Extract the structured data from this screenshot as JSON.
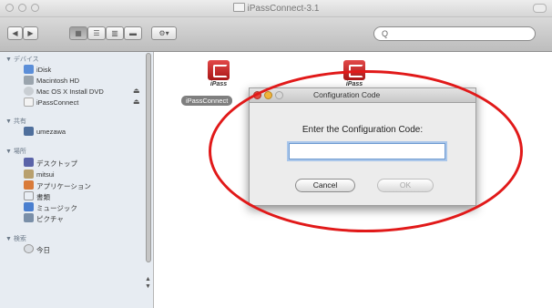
{
  "window": {
    "title": "iPassConnect-3.1"
  },
  "toolbar": {
    "nav_back": "◀",
    "nav_forward": "▶",
    "view_modes": [
      "▦",
      "☰",
      "▥",
      "▬"
    ],
    "action": "⚙▾",
    "search_placeholder": "Q"
  },
  "sidebar": {
    "sections": [
      {
        "header": "▼ デバイス",
        "items": [
          {
            "label": "iDisk",
            "icon": "idisk-icon",
            "eject": false
          },
          {
            "label": "Macintosh HD",
            "icon": "hard-disk-icon",
            "eject": false
          },
          {
            "label": "Mac OS X Install DVD",
            "icon": "dvd-icon",
            "eject": true
          },
          {
            "label": "iPassConnect",
            "icon": "disk-image-icon",
            "eject": true
          }
        ]
      },
      {
        "header": "▼ 共有",
        "items": [
          {
            "label": "umezawa",
            "icon": "shared-computer-icon",
            "eject": false
          }
        ]
      },
      {
        "header": "▼ 場所",
        "items": [
          {
            "label": "デスクトップ",
            "icon": "desktop-icon",
            "eject": false
          },
          {
            "label": "mitsui",
            "icon": "home-icon",
            "eject": false
          },
          {
            "label": "アプリケーション",
            "icon": "applications-icon",
            "eject": false
          },
          {
            "label": "書類",
            "icon": "documents-icon",
            "eject": false
          },
          {
            "label": "ミュージック",
            "icon": "music-icon",
            "eject": false
          },
          {
            "label": "ピクチャ",
            "icon": "pictures-icon",
            "eject": false
          }
        ]
      },
      {
        "header": "▼ 検索",
        "items": [
          {
            "label": "今日",
            "icon": "clock-icon",
            "eject": false
          }
        ]
      }
    ],
    "eject_glyph": "⏏"
  },
  "files": [
    {
      "name": "iPassConnect",
      "badge": "iPass",
      "selected": true
    },
    {
      "name": "",
      "badge": "iPass",
      "selected": false
    }
  ],
  "dialog": {
    "title": "Configuration Code",
    "prompt": "Enter the Configuration Code:",
    "input_value": "",
    "cancel_label": "Cancel",
    "ok_label": "OK"
  },
  "colors": {
    "annotation_ellipse": "#e11919",
    "focus_ring": "#6f9bd1",
    "icon_red": "#c42020"
  }
}
